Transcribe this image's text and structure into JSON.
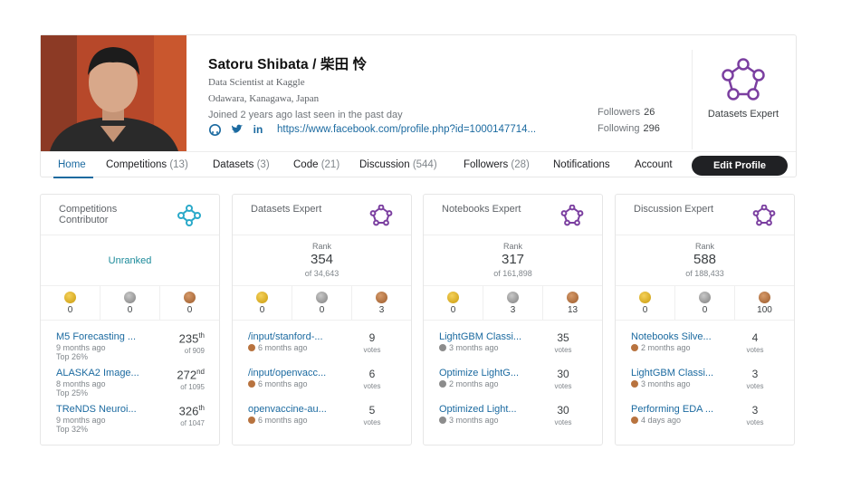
{
  "profile": {
    "name": "Satoru Shibata / 柴田 怜",
    "occupation": "Data Scientist at Kaggle",
    "location": "Odawara, Kanagawa, Japan",
    "joined": "Joined 2 years ago last seen in the past day",
    "url": "https://www.facebook.com/profile.php?id=1000147714...",
    "followers_label": "Followers",
    "followers_count": "26",
    "following_label": "Following",
    "following_count": "296",
    "tier_badge_label": "Datasets Expert"
  },
  "tabs": [
    {
      "label": "Home",
      "count": ""
    },
    {
      "label": "Competitions",
      "count": "(13)"
    },
    {
      "label": "Datasets",
      "count": "(3)"
    },
    {
      "label": "Code",
      "count": "(21)"
    },
    {
      "label": "Discussion",
      "count": "(544)"
    },
    {
      "label": "Followers",
      "count": "(28)"
    },
    {
      "label": "Notifications",
      "count": ""
    },
    {
      "label": "Account",
      "count": ""
    }
  ],
  "edit_profile_label": "Edit Profile",
  "cards": {
    "competitions": {
      "title": "Competitions Contributor",
      "unranked": "Unranked",
      "medals": {
        "gold": "0",
        "silver": "0",
        "bronze": "0"
      },
      "items": [
        {
          "title": "M5 Forecasting ...",
          "ago": "9 months ago",
          "top": "Top 26%",
          "rank": "235",
          "suffix": "th",
          "of": "of 909"
        },
        {
          "title": "ALASKA2 Image...",
          "ago": "8 months ago",
          "top": "Top 25%",
          "rank": "272",
          "suffix": "nd",
          "of": "of 1095"
        },
        {
          "title": "TReNDS Neuroi...",
          "ago": "9 months ago",
          "top": "Top 32%",
          "rank": "326",
          "suffix": "th",
          "of": "of 1047"
        }
      ]
    },
    "datasets": {
      "title": "Datasets Expert",
      "rank_label": "Rank",
      "rank": "354",
      "rank_of": "of 34,643",
      "medals": {
        "gold": "0",
        "silver": "0",
        "bronze": "3"
      },
      "items": [
        {
          "title": "/input/stanford-...",
          "ago": "6 months ago",
          "medal": "bronze",
          "votes": "9",
          "votes_label": "votes"
        },
        {
          "title": "/input/openvacc...",
          "ago": "6 months ago",
          "medal": "bronze",
          "votes": "6",
          "votes_label": "votes"
        },
        {
          "title": "openvaccine-au...",
          "ago": "6 months ago",
          "medal": "bronze",
          "votes": "5",
          "votes_label": "votes"
        }
      ]
    },
    "notebooks": {
      "title": "Notebooks Expert",
      "rank_label": "Rank",
      "rank": "317",
      "rank_of": "of 161,898",
      "medals": {
        "gold": "0",
        "silver": "3",
        "bronze": "13"
      },
      "items": [
        {
          "title": "LightGBM Classi...",
          "ago": "3 months ago",
          "medal": "silver",
          "votes": "35",
          "votes_label": "votes"
        },
        {
          "title": "Optimize LightG...",
          "ago": "2 months ago",
          "medal": "silver",
          "votes": "30",
          "votes_label": "votes"
        },
        {
          "title": "Optimized Light...",
          "ago": "3 months ago",
          "medal": "silver",
          "votes": "30",
          "votes_label": "votes"
        }
      ]
    },
    "discussion": {
      "title": "Discussion Expert",
      "rank_label": "Rank",
      "rank": "588",
      "rank_of": "of 188,433",
      "medals": {
        "gold": "0",
        "silver": "0",
        "bronze": "100"
      },
      "items": [
        {
          "title": "Notebooks Silve...",
          "ago": "2 months ago",
          "medal": "bronze",
          "votes": "4",
          "votes_label": "votes"
        },
        {
          "title": "LightGBM Classi...",
          "ago": "3 months ago",
          "medal": "bronze",
          "votes": "3",
          "votes_label": "votes"
        },
        {
          "title": "Performing EDA ...",
          "ago": "4 days ago",
          "medal": "bronze",
          "votes": "3",
          "votes_label": "votes"
        }
      ]
    }
  },
  "colors": {
    "link": "#1b6aa0",
    "accent_purple": "#7b3fa0",
    "competitions_icon": "#2aa9c9",
    "button_dark": "#202124"
  }
}
